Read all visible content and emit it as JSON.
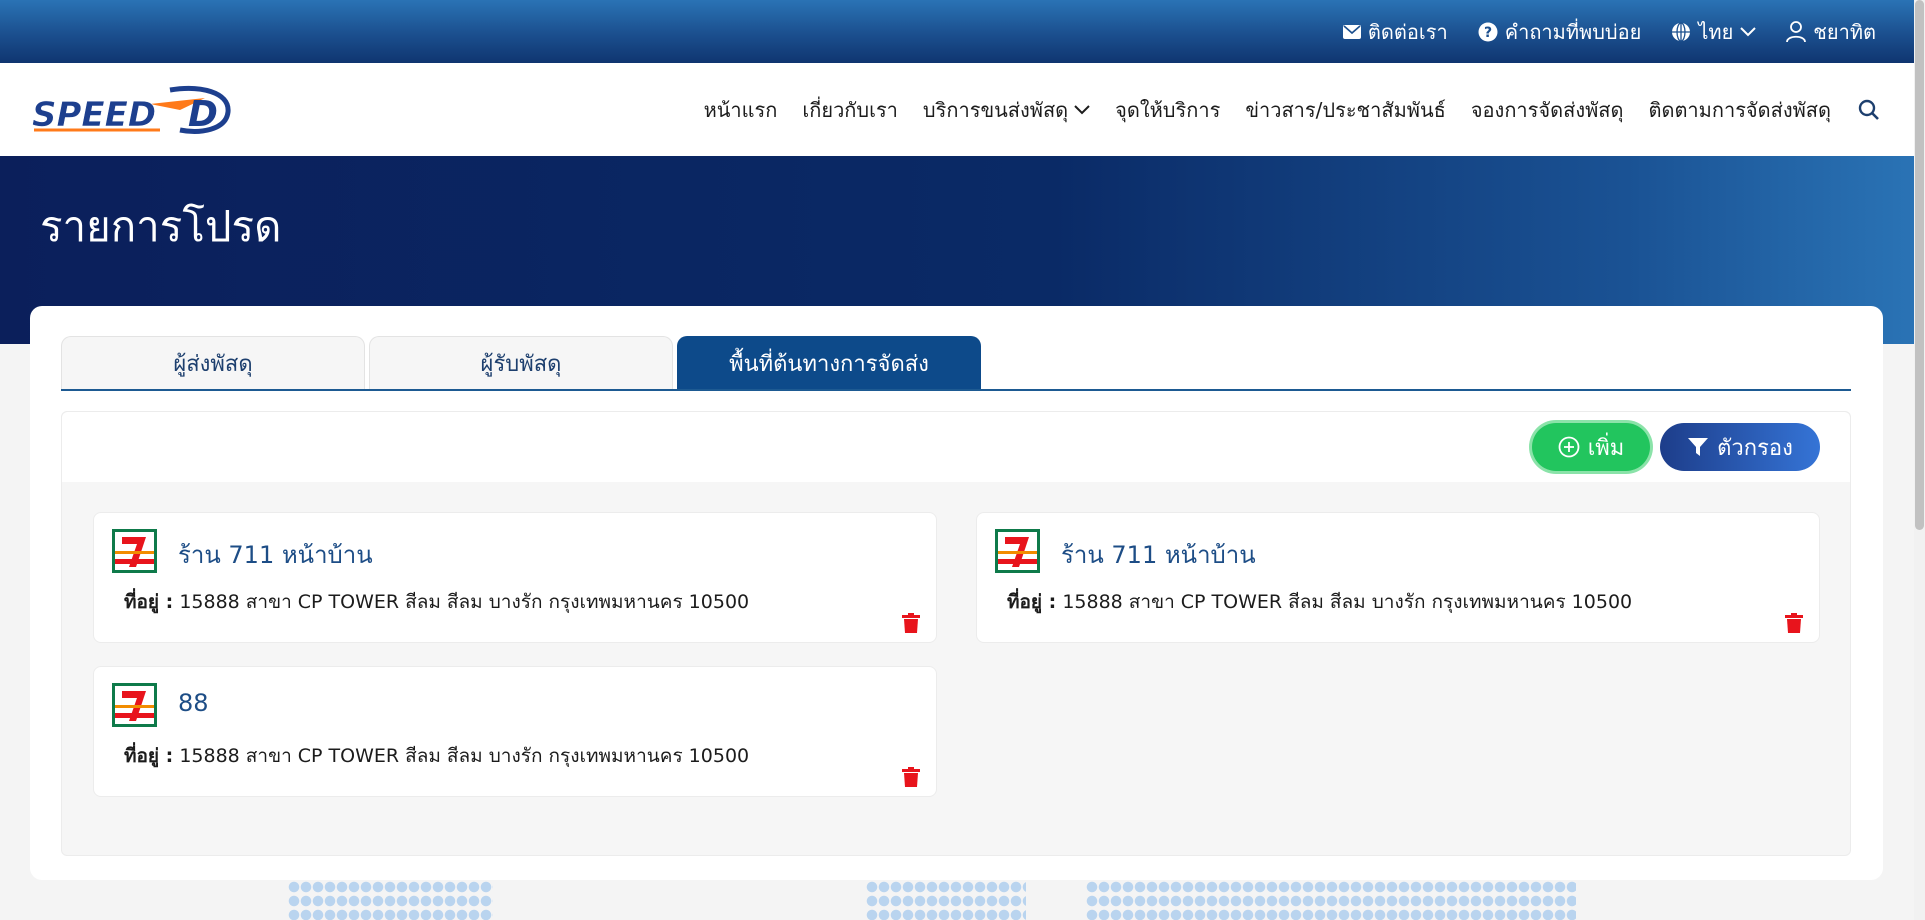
{
  "topbar": {
    "contact_label": "ติดต่อเรา",
    "faq_label": "คำถามที่พบบ่อย",
    "language_label": "ไทย",
    "user_label": "ชยาทิต"
  },
  "brand": {
    "logo_text": "SPEED-D",
    "logo_sub": "SPEED-D"
  },
  "nav": {
    "items": [
      {
        "label": "หน้าแรก"
      },
      {
        "label": "เกี่ยวกับเรา"
      },
      {
        "label": "บริการขนส่งพัสดุ"
      },
      {
        "label": "จุดให้บริการ"
      },
      {
        "label": "ข่าวสาร/ประชาสัมพันธ์"
      },
      {
        "label": "จองการจัดส่งพัสดุ"
      },
      {
        "label": "ติดตามการจัดส่งพัสดุ"
      }
    ]
  },
  "page": {
    "title": "รายการโปรด"
  },
  "tabs": [
    {
      "label": "ผู้ส่งพัสดุ"
    },
    {
      "label": "ผู้รับพัสดุ"
    },
    {
      "label": "พื้นที่ต้นทางการจัดส่ง"
    }
  ],
  "toolbar": {
    "add_label": "เพิ่ม",
    "filter_label": "ตัวกรอง"
  },
  "cards": [
    {
      "name": "ร้าน 711 หน้าบ้าน",
      "address_label": "ที่อยู่ :",
      "address": "15888 สาขา CP TOWER สีลม สีลม บางรัก กรุงเทพมหานคร 10500"
    },
    {
      "name": "ร้าน 711 หน้าบ้าน",
      "address_label": "ที่อยู่ :",
      "address": "15888 สาขา CP TOWER สีลม สีลม บางรัก กรุงเทพมหานคร 10500"
    },
    {
      "name": "88",
      "address_label": "ที่อยู่ :",
      "address": "15888 สาขา CP TOWER สีลม สีลม บางรัก กรุงเทพมหานคร 10500"
    }
  ],
  "colors": {
    "brand_blue": "#0d4a8a",
    "add_green": "#22c55e",
    "delete_red": "#e8141c"
  }
}
